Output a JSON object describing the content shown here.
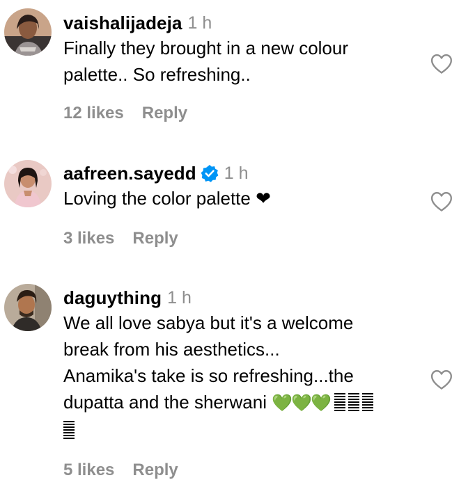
{
  "comments": [
    {
      "username": "vaishalijadeja",
      "time": "1 h",
      "verified": false,
      "lines": [
        "Finally they brought in a new colour",
        "palette.. So refreshing.."
      ],
      "likes": "12 likes",
      "reply": "Reply"
    },
    {
      "username": "aafreen.sayedd",
      "time": "1 h",
      "verified": true,
      "lines": [
        "Loving the color palette ❤"
      ],
      "likes": "3 likes",
      "reply": "Reply"
    },
    {
      "username": "daguything",
      "time": "1 h",
      "verified": false,
      "lines": [
        "We all love sabya but it's a welcome",
        "break from his aesthetics...",
        "Anamika's take is so refreshing...the",
        "dupatta and the sherwani "
      ],
      "emoji": "💚💚💚",
      "likes": "5 likes",
      "reply": "Reply"
    }
  ],
  "icons": {
    "like": "heart-outline-icon",
    "verified": "verified-badge-icon"
  },
  "colors": {
    "secondary_text": "#8e8e8e",
    "verified_blue": "#0095f6",
    "emoji_green": "#22c55e"
  }
}
